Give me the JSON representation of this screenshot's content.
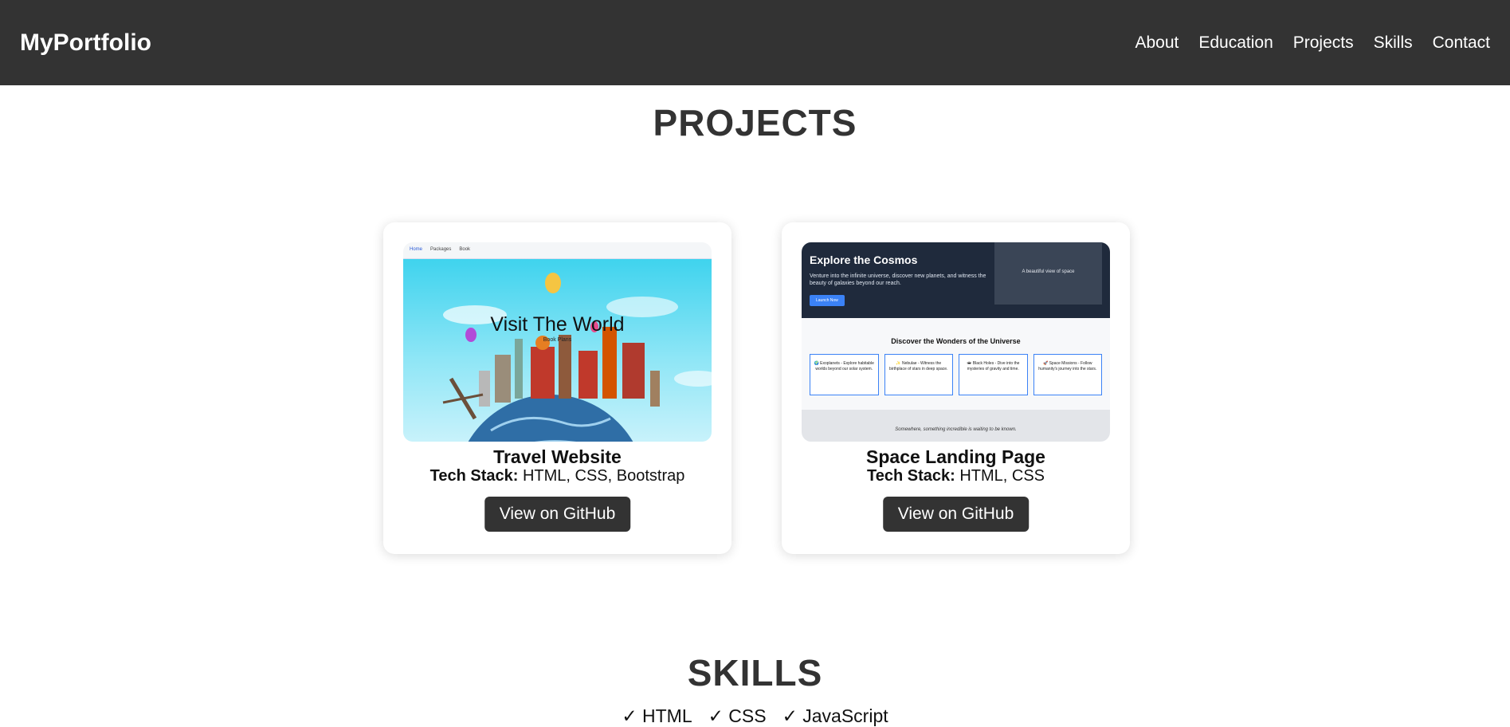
{
  "nav": {
    "brand": "MyPortfolio",
    "links": [
      "About",
      "Education",
      "Projects",
      "Skills",
      "Contact"
    ]
  },
  "projects": {
    "title": "PROJECTS",
    "items": [
      {
        "name": "Travel Website",
        "stack_label": "Tech Stack:",
        "stack": "HTML, CSS, Bootstrap",
        "button": "View on GitHub",
        "thumbnail": {
          "nav_items": [
            "Home",
            "Packages",
            "Book"
          ],
          "headline": "Visit The World",
          "subtext": "Book Plans"
        }
      },
      {
        "name": "Space Landing Page",
        "stack_label": "Tech Stack:",
        "stack": "HTML, CSS",
        "button": "View on GitHub",
        "thumbnail": {
          "heading": "Explore the Cosmos",
          "description": "Venture into the infinite universe, discover new planets, and witness the beauty of galaxies beyond our reach.",
          "cta": "Launch Now",
          "image_alt": "A beautiful view of space",
          "section_title": "Discover the Wonders of the Universe",
          "tiles": [
            "🌍 Exoplanets - Explore habitable worlds beyond our solar system.",
            "✨ Nebulae - Witness the birthplace of stars in deep space.",
            "🕳 Black Holes - Dive into the mysteries of gravity and time.",
            "🚀 Space Missions - Follow humanity's journey into the stars."
          ],
          "footer_quote": "Somewhere, something incredible is waiting to be known."
        }
      }
    ]
  },
  "skills": {
    "title": "SKILLS",
    "items": [
      "✓ HTML",
      "✓ CSS",
      "✓ JavaScript"
    ]
  }
}
